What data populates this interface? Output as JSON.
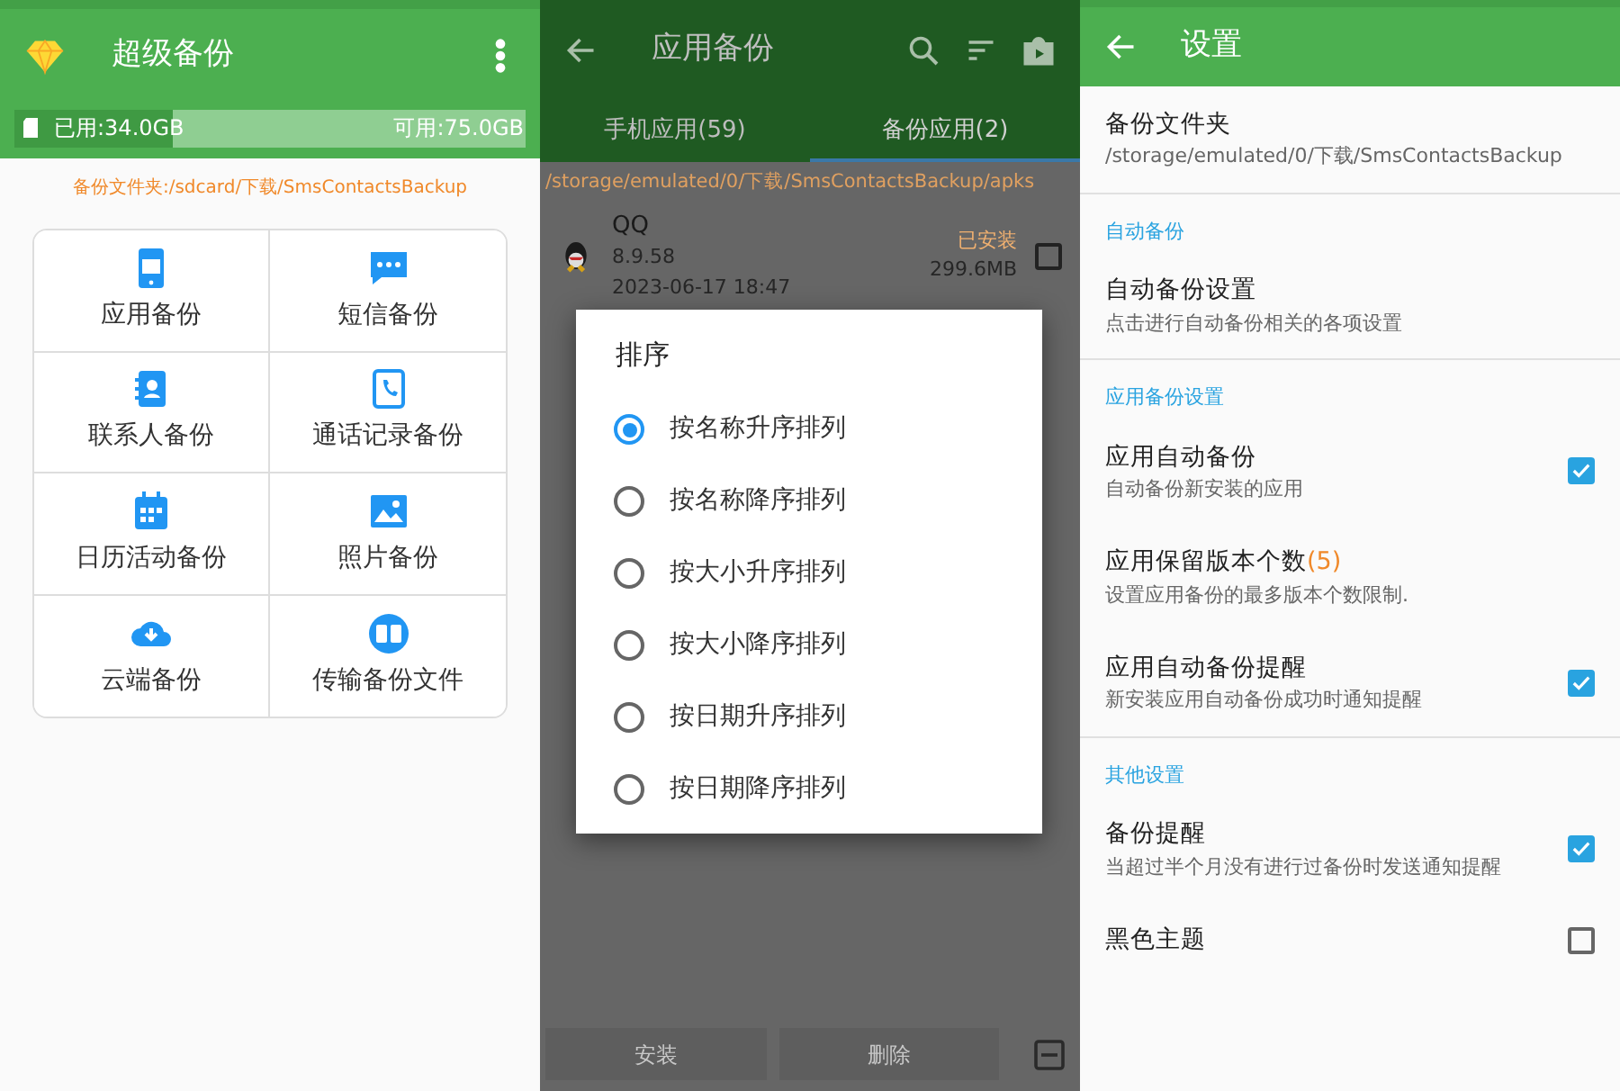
{
  "home": {
    "title": "超级备份",
    "storage": {
      "used": "已用:34.0GB",
      "free": "可用:75.0GB",
      "level": 0.31
    },
    "folder": "备份文件夹:/sdcard/下载/SmsContactsBackup",
    "tiles": [
      {
        "label": "应用备份"
      },
      {
        "label": "短信备份"
      },
      {
        "label": "联系人备份"
      },
      {
        "label": "通话记录备份"
      },
      {
        "label": "日历活动备份"
      },
      {
        "label": "照片备份"
      },
      {
        "label": "云端备份"
      },
      {
        "label": "传输备份文件"
      }
    ]
  },
  "app_backup": {
    "title": "应用备份",
    "tabs": [
      {
        "label": "手机应用(59)",
        "selected": false
      },
      {
        "label": "备份应用(2)",
        "selected": true
      }
    ],
    "path": "/storage/emulated/0/下载/SmsContactsBackup/apks",
    "apps": [
      {
        "name": "QQ",
        "version": "8.9.58",
        "date": "2023-06-17 18:47",
        "status": "已安装",
        "size": "299.6MB",
        "checked": false
      }
    ],
    "dialog": {
      "title": "排序",
      "options": [
        {
          "label": "按名称升序排列",
          "selected": true
        },
        {
          "label": "按名称降序排列",
          "selected": false
        },
        {
          "label": "按大小升序排列",
          "selected": false
        },
        {
          "label": "按大小降序排列",
          "selected": false
        },
        {
          "label": "按日期升序排列",
          "selected": false
        },
        {
          "label": "按日期降序排列",
          "selected": false
        }
      ]
    },
    "buttons": [
      "安装",
      "删除"
    ]
  },
  "settings": {
    "title": "设置",
    "items": [
      {
        "kind": "pref",
        "title": "备份文件夹",
        "summary": "/storage/emulated/0/下载/SmsContactsBackup",
        "divider": true
      },
      {
        "kind": "header",
        "title": "自动备份"
      },
      {
        "kind": "pref",
        "title": "自动备份设置",
        "summary": "点击进行自动备份相关的各项设置",
        "divider": true
      },
      {
        "kind": "header",
        "title": "应用备份设置"
      },
      {
        "kind": "check",
        "title": "应用自动备份",
        "summary": "自动备份新安装的应用",
        "checked": true
      },
      {
        "kind": "pref",
        "title": "应用保留版本个数",
        "count": "(5)",
        "summary": "设置应用备份的最多版本个数限制."
      },
      {
        "kind": "check",
        "title": "应用自动备份提醒",
        "summary": "新安装应用自动备份成功时通知提醒",
        "checked": true,
        "divider": true
      },
      {
        "kind": "header",
        "title": "其他设置"
      },
      {
        "kind": "check",
        "title": "备份提醒",
        "summary": "当超过半个月没有进行过备份时发送通知提醒",
        "checked": true
      },
      {
        "kind": "check",
        "title": "黑色主题",
        "checked": false
      }
    ]
  }
}
